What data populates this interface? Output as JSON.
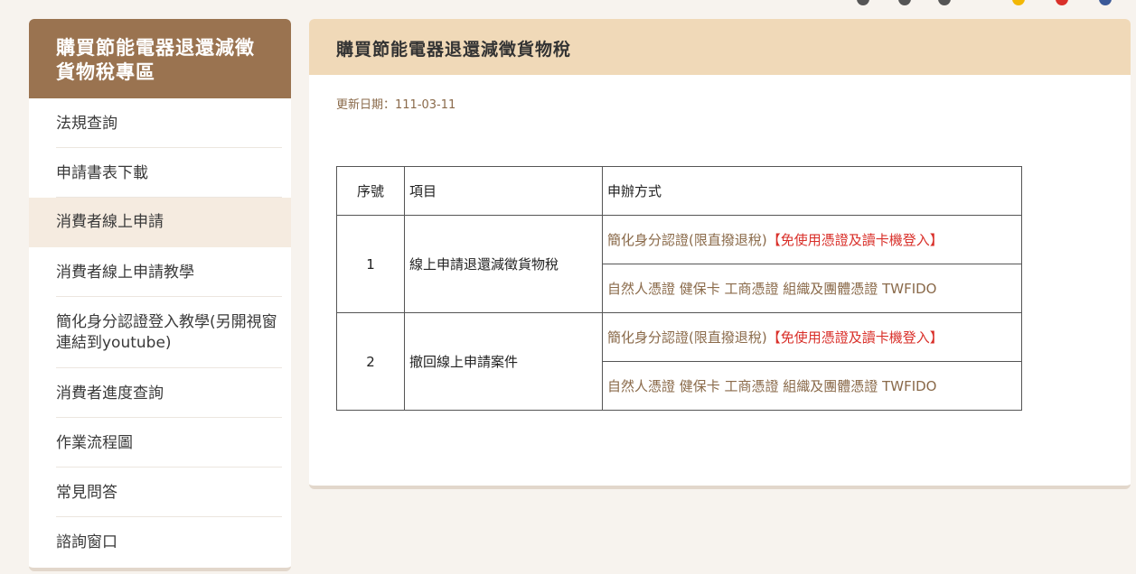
{
  "colors": {
    "sidebar_header": "#9a7350",
    "main_header": "#f0d9b8",
    "link_text": "#8a6a4a",
    "warning_text": "#d9302a",
    "active_menu": "#f5ebe0"
  },
  "sidebar": {
    "title": "購買節能電器退還減徵貨物稅專區",
    "items": [
      {
        "label": "法規查詢"
      },
      {
        "label": "申請書表下載"
      },
      {
        "label": "消費者線上申請",
        "active": true
      },
      {
        "label": "消費者線上申請教學"
      },
      {
        "label": "簡化身分認證登入教學(另開視窗連結到youtube)"
      },
      {
        "label": "消費者進度查詢"
      },
      {
        "label": "作業流程圖"
      },
      {
        "label": "常見問答"
      },
      {
        "label": "諮詢窗口"
      }
    ]
  },
  "main": {
    "title": "購買節能電器退還減徵貨物稅",
    "update_date": "更新日期：111-03-11",
    "table": {
      "headers": {
        "no": "序號",
        "item": "項目",
        "method": "申辦方式"
      },
      "rows": [
        {
          "no": "1",
          "item": "線上申請退還減徵貨物稅",
          "method_simple": "簡化身分認證(限直撥退稅)",
          "method_simple_note": "【免使用憑證及讀卡機登入】",
          "method_certs": "自然人憑證 健保卡 工商憑證 組織及團體憑證 TWFIDO"
        },
        {
          "no": "2",
          "item": "撤回線上申請案件",
          "method_simple": "簡化身分認證(限直撥退稅)",
          "method_simple_note": "【免使用憑證及讀卡機登入】",
          "method_certs": "自然人憑證 健保卡 工商憑證 組織及團體憑證 TWFIDO"
        }
      ]
    }
  }
}
